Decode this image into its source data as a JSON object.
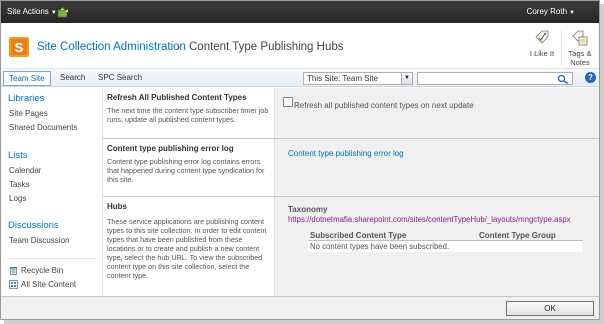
{
  "topbar": {
    "site_actions_label": "Site Actions",
    "user_name": "Corey Roth"
  },
  "header": {
    "breadcrumb_root": "Site Collection Administration",
    "breadcrumb_separator": "›",
    "page_title": "Content Type Publishing Hubs",
    "like_it_label": "I Like It",
    "tags_line1": "Tags &",
    "tags_line2": "Notes"
  },
  "nav": {
    "tabs": [
      {
        "label": "Team Site",
        "active": true
      },
      {
        "label": "Search",
        "active": false
      },
      {
        "label": "SPC Search",
        "active": false
      }
    ],
    "search_scope": "This Site: Team Site",
    "search_value": "",
    "help_label": "?"
  },
  "quick_launch": {
    "libraries_heading": "Libraries",
    "libraries_items": [
      "Site Pages",
      "Shared Documents"
    ],
    "lists_heading": "Lists",
    "lists_items": [
      "Calendar",
      "Tasks",
      "Logs"
    ],
    "discussions_heading": "Discussions",
    "discussions_items": [
      "Team Discussion"
    ],
    "recycle_bin": "Recycle Bin",
    "all_site_content": "All Site Content"
  },
  "sections": {
    "refresh": {
      "title": "Refresh All Published Content Types",
      "desc": "The next time the content type subscriber timer job runs, update all published content types.",
      "checkbox_label": "Refresh all published content types on next update",
      "checked": false
    },
    "error_log": {
      "title": "Content type publishing error log",
      "desc": "Content type publishing error log contains errors that happened during content type syndication for this site.",
      "link_text": "Content type publishing error log"
    },
    "hubs": {
      "title": "Hubs",
      "desc": "These service applications are publishing content types to this site collection. In order to edit content types that have been published from these locations or to create and publish a new content type, select the hub URL. To view the subscribed content type on this site collection, select the content type.",
      "service_name": "Taxonomy",
      "hub_url": "https://dotnetmafia.sharepoint.com/sites/contentTypeHub/_layouts/mngctype.aspx",
      "col_subscribed": "Subscribed Content Type",
      "col_group": "Content Type Group",
      "empty_message": "No content types have been subscribed."
    }
  },
  "footer": {
    "ok_label": "OK"
  },
  "colors": {
    "link": "#0072bc",
    "visited_link": "#8a1e8a",
    "topbar": "#2e2e2e",
    "section_right_bg": "#f0f0f0"
  }
}
